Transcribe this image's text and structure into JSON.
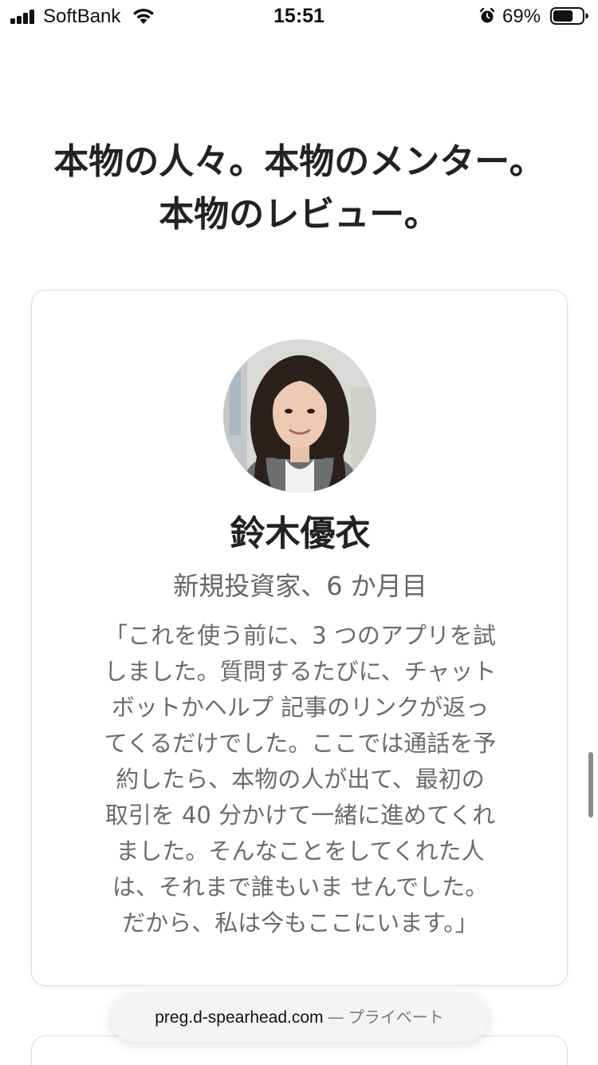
{
  "status_bar": {
    "carrier": "SoftBank",
    "time": "15:51",
    "battery_percent": "69%",
    "battery_level": 0.69,
    "icons": [
      "signal-icon",
      "wifi-icon",
      "alarm-icon",
      "battery-icon"
    ]
  },
  "headline": {
    "line1": "本物の人々。本物のメンター。",
    "line2": "本物のレビュー。"
  },
  "review": {
    "name": "鈴木優衣",
    "role": "新規投資家、6 か月目",
    "quote_lines": [
      "「これを使う前に、3 つのアプリを試",
      "しました。質問するたびに、チャット",
      "ボットかヘルプ 記事のリンクが返っ",
      "てくるだけでした。ここでは通話を予",
      "約したら、本物の人が出て、最初の",
      "取引を 40 分かけて一緒に進めてくれ",
      "ました。そんなことをしてくれた人",
      "は、それまで誰もいま せんでした。",
      "だから、私は今もここにいます。」"
    ]
  },
  "browser": {
    "url_host": "preg.d-spearhead.com",
    "separator": "—",
    "mode_label": "プライベート"
  }
}
